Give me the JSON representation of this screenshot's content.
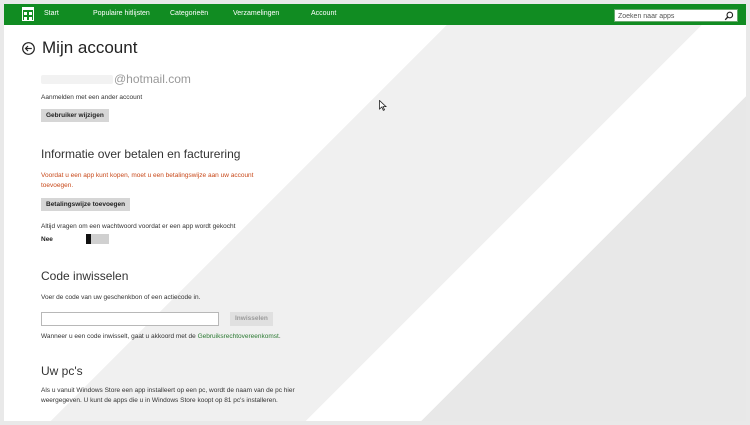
{
  "colors": {
    "accent": "#118c22",
    "warning": "#c8491a",
    "link": "#2b7a32",
    "button": "#d6d6d6"
  },
  "topbar": {
    "items": [
      {
        "label": "Start"
      },
      {
        "label": "Populaire hitlijsten"
      },
      {
        "label": "Categorieën"
      },
      {
        "label": "Verzamelingen"
      },
      {
        "label": "Account"
      }
    ],
    "search": {
      "placeholder": "Zoeken naar apps",
      "icon": "search-icon"
    }
  },
  "page": {
    "title": "Mijn account",
    "email_domain": "@hotmail.com",
    "signin_text": "Aanmelden met een ander account",
    "change_user_button": "Gebruiker wijzigen"
  },
  "billing": {
    "title": "Informatie over betalen en facturering",
    "warning": "Voordat u een app kunt kopen, moet u een betalingswijze aan uw account toevoegen.",
    "add_payment_button": "Betalingswijze toevoegen",
    "password_prompt": "Altijd vragen om een wachtwoord voordat er een app wordt gekocht",
    "toggle_value": "Nee"
  },
  "redeem": {
    "title": "Code inwisselen",
    "instructions": "Voer de code van uw geschenkbon of een actiecode in.",
    "code_value": "",
    "redeem_button": "Inwisselen",
    "terms_text": "Wanneer u een code inwisselt, gaat u akkoord met de ",
    "terms_link": "Gebruiksrechtovereenkomst",
    "terms_end": "."
  },
  "pcs": {
    "title": "Uw pc's",
    "text": "Als u vanuit Windows Store een app installeert op een pc, wordt de naam van de pc hier weergegeven. U kunt de apps die u in Windows Store koopt op 81 pc's installeren."
  }
}
